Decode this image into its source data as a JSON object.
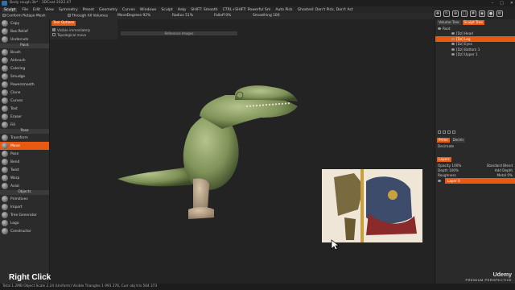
{
  "window": {
    "title": "Body rough.3b* - 3DCoat 2022.47",
    "controls": [
      "–",
      "□",
      "✕"
    ]
  },
  "menu": [
    "Sculpt",
    "File",
    "Edit",
    "View",
    "Symmetry",
    "Preset",
    "Geometry",
    "Curves",
    "Windows",
    "Sculpt",
    "Help",
    "SHIFT: Smooth",
    "CTRL+SHIFT: Powerful Sm",
    "Auto Pick",
    "Ghosted: Don't Pick, Don't Act"
  ],
  "toolbar": {
    "conform": "Conform Retopo Mesh",
    "through": "Through All Volumes",
    "depth": "MoveDegrees 92%",
    "radius": "Radius 51%",
    "falloff": "Falloff 0%",
    "smoothing": "Smoothing 100"
  },
  "left": {
    "copy": "Copy",
    "basrelief": "Bas-Relief",
    "undercuts": "Undercuts",
    "paint_header": "Paint",
    "paint_tools": [
      "Brush",
      "Airbrush",
      "Coloring",
      "Smudge",
      "Powersmooth",
      "Clone",
      "Curves",
      "Text",
      "Eraser",
      "Fill"
    ],
    "pose_header": "Pose",
    "pose_tools": [
      "Transform",
      "Move",
      "Pose",
      "Bend",
      "Twist",
      "Warp",
      "Axial"
    ],
    "objects_header": "Objects",
    "objects_tools": [
      "Primitives",
      "Import",
      "Tree Generator",
      "Logo",
      "Constructor"
    ]
  },
  "options": {
    "tabs": [
      "Tool Options"
    ],
    "visible": "Visible immediately",
    "topological": "Topological move"
  },
  "viewport": {
    "refbar": "Reference Images"
  },
  "right": {
    "tabs": [
      "Volume Tree",
      "Sculpt Tree"
    ],
    "tree": [
      "Root",
      "[Dz] Head",
      "[Dz] Leg",
      "[Dz] Eyes",
      "[Dz] Bottom 1",
      "[Dz] Upper 1"
    ],
    "props_tabs": [
      "Prims",
      "Decim"
    ],
    "decimate": "Decimate",
    "layers_tab": "Layers",
    "opacity": "Opacity 100%",
    "blend": "Standard Blend",
    "depth": "Depth 100%",
    "add_depth": "Add Depth",
    "roughness": "Roughness",
    "metal": "Metal 0%",
    "layer_name": "Layer 0"
  },
  "status": "Total 1.2MB   Object Scale 2.24 (Uniform)   Visible Triangles 1 991 276, Curr obj tris 564 373",
  "caption": "Right Click",
  "watermark": {
    "brand": "Udemy",
    "line": "PREMIUM PERSPECTIVE"
  }
}
